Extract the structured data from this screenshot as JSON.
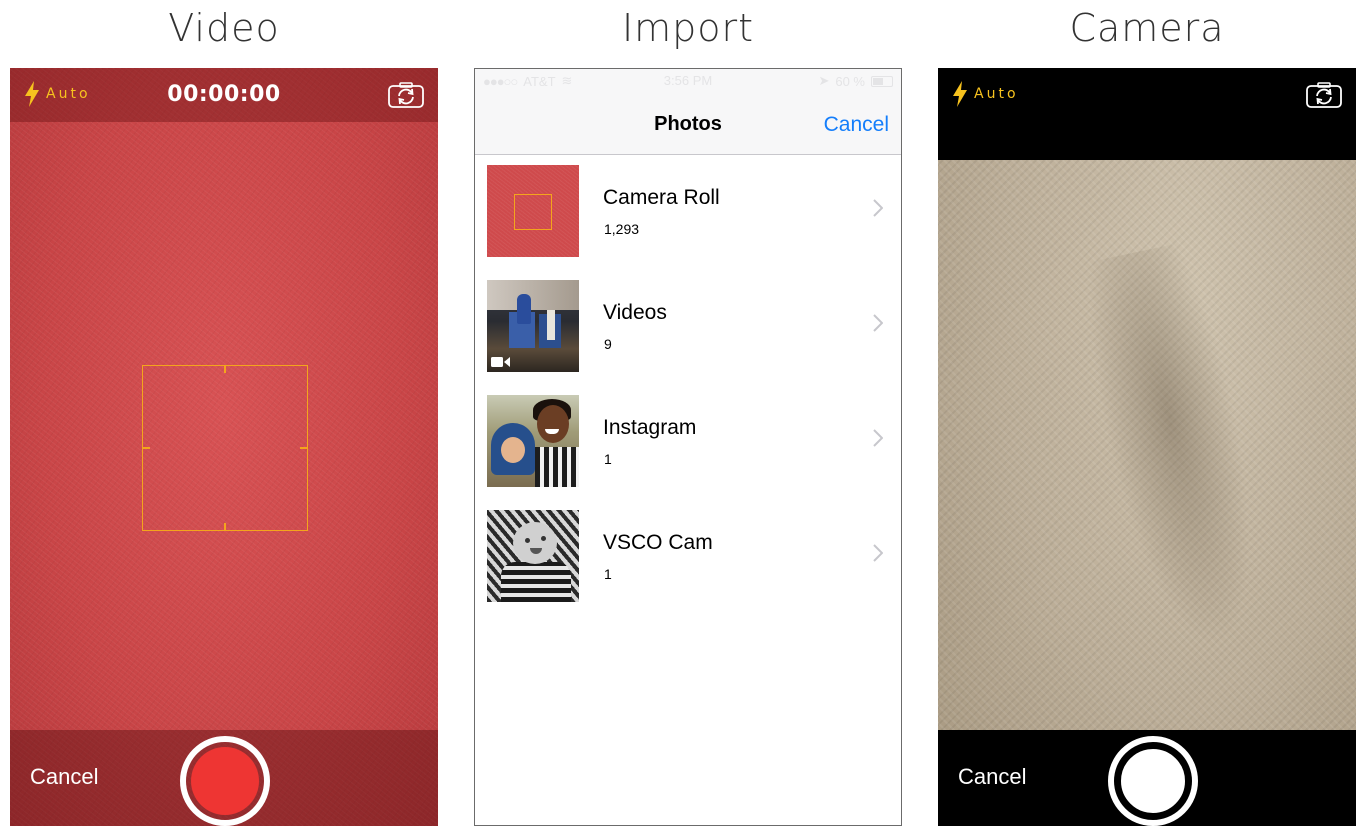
{
  "labels": {
    "video": "Video",
    "import": "Import",
    "camera": "Camera"
  },
  "video_screen": {
    "flash_label": "Auto",
    "timer": "00:00:00",
    "cancel_label": "Cancel",
    "colors": {
      "flash": "#f7c21e",
      "focus_box": "#f4a51c",
      "record_button": "#ee3533"
    }
  },
  "import_screen": {
    "status_bar": {
      "carrier": "AT&T",
      "time": "3:56 PM",
      "battery": "60 %"
    },
    "nav": {
      "title": "Photos",
      "cancel_label": "Cancel"
    },
    "albums": [
      {
        "name": "Camera Roll",
        "count": "1,293"
      },
      {
        "name": "Videos",
        "count": "9"
      },
      {
        "name": "Instagram",
        "count": "1"
      },
      {
        "name": "VSCO Cam",
        "count": "1"
      }
    ],
    "colors": {
      "accent": "#147efb"
    }
  },
  "camera_screen": {
    "flash_label": "Auto",
    "cancel_label": "Cancel"
  },
  "icons": {
    "flash": "lightning-bolt-icon",
    "switch_camera": "switch-camera-icon",
    "chevron": "chevron-right-icon",
    "video_badge": "video-camera-icon"
  }
}
